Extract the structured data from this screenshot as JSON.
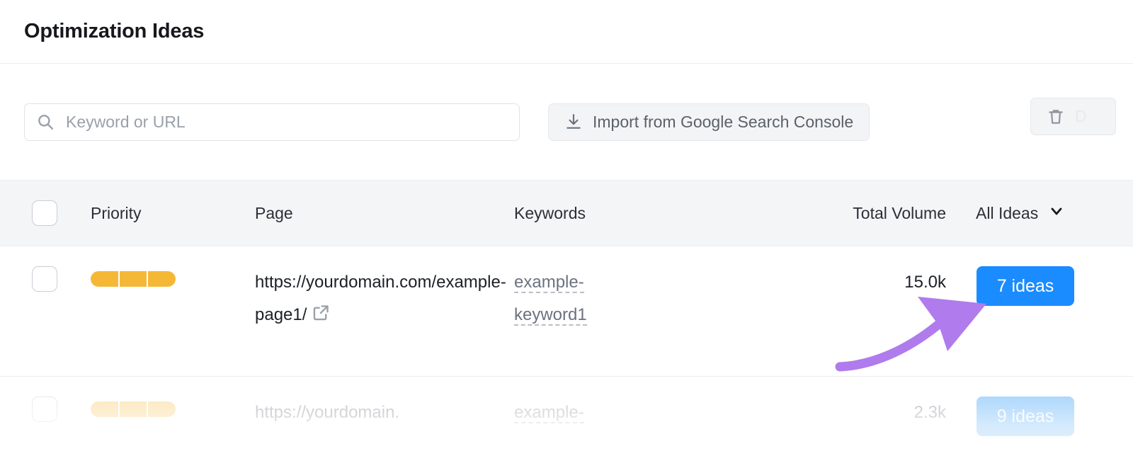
{
  "header": {
    "title": "Optimization Ideas"
  },
  "toolbar": {
    "search_placeholder": "Keyword or URL",
    "search_value": "",
    "search_icon": "search-icon",
    "import_label": "Import from Google Search Console",
    "import_icon": "download-icon",
    "delete_label": "D",
    "delete_icon": "trash-icon"
  },
  "table": {
    "columns": {
      "priority": "Priority",
      "page": "Page",
      "keywords": "Keywords",
      "volume": "Total Volume",
      "ideas_filter": "All Ideas"
    },
    "ideas_filter_icon": "chevron-down-icon",
    "rows": [
      {
        "priority_segments": 3,
        "page": "https://yourdomain.com/example-page1/",
        "page_icon": "external-link-icon",
        "keyword": "example-keyword1",
        "volume": "15.0k",
        "ideas": "7 ideas"
      },
      {
        "priority_segments": 3,
        "page": "https://yourdomain.",
        "page_icon": "external-link-icon",
        "keyword": "example-",
        "volume": "2.3k",
        "ideas": "9 ideas"
      }
    ]
  },
  "annotation": {
    "type": "curved-arrow",
    "color": "#b07bec",
    "points_to": "7 ideas"
  },
  "colors": {
    "badge_blue": "#1a8cff",
    "priority_amber": "#f5b836",
    "header_band": "#f4f5f7",
    "annotation_purple": "#b07bec"
  }
}
